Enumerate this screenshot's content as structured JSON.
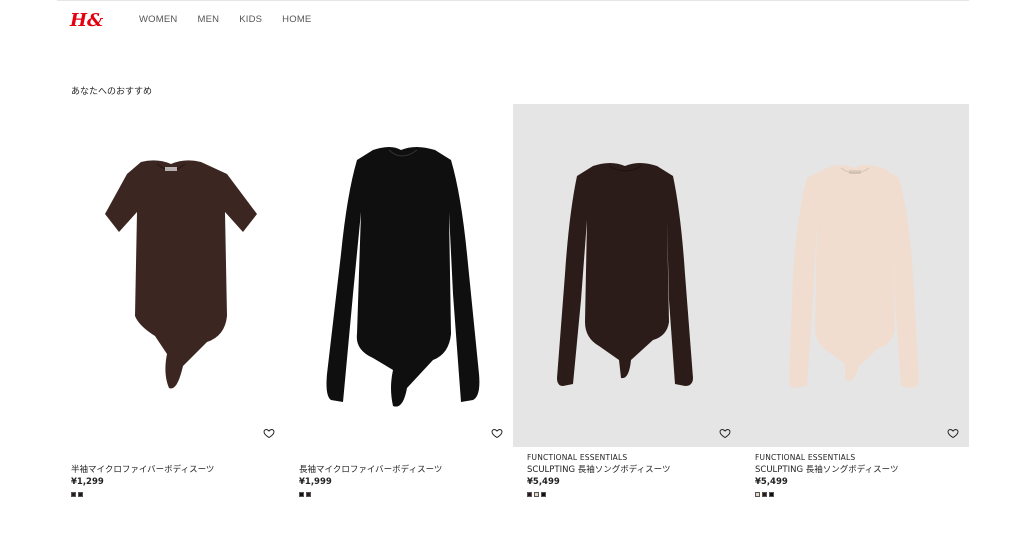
{
  "brand": {
    "logo_text": "H&M"
  },
  "nav": [
    {
      "label": "WOMEN"
    },
    {
      "label": "MEN"
    },
    {
      "label": "KIDS"
    },
    {
      "label": "HOME"
    }
  ],
  "section_title": "あなたへのおすすめ",
  "products": [
    {
      "brand": "",
      "name": "半袖マイクロファイバーボディスーツ",
      "price": "¥1,299",
      "background": "white",
      "garment_color": "#3c2622",
      "swatches": [
        "#2a1e1c",
        "#1a1a1a"
      ]
    },
    {
      "brand": "",
      "name": "長袖マイクロファイバーボディスーツ",
      "price": "¥1,999",
      "background": "white",
      "garment_color": "#0f0f10",
      "swatches": [
        "#111111",
        "#2a1e1c"
      ]
    },
    {
      "brand": "FUNCTIONAL ESSENTIALS",
      "name": "SCULPTING 長袖ソングボディスーツ",
      "price": "¥5,499",
      "background": "grey",
      "garment_color": "#2c1c19",
      "swatches": [
        "#2c1c19",
        "#e8d7c7",
        "#111111"
      ]
    },
    {
      "brand": "FUNCTIONAL ESSENTIALS",
      "name": "SCULPTING 長袖ソングボディスーツ",
      "price": "¥5,499",
      "background": "grey",
      "garment_color": "#f1ddd0",
      "swatches": [
        "#e8d7c7",
        "#2c1c19",
        "#111111"
      ]
    }
  ],
  "colors": {
    "accent": "#e50010",
    "grey_bg": "#e5e5e5"
  }
}
